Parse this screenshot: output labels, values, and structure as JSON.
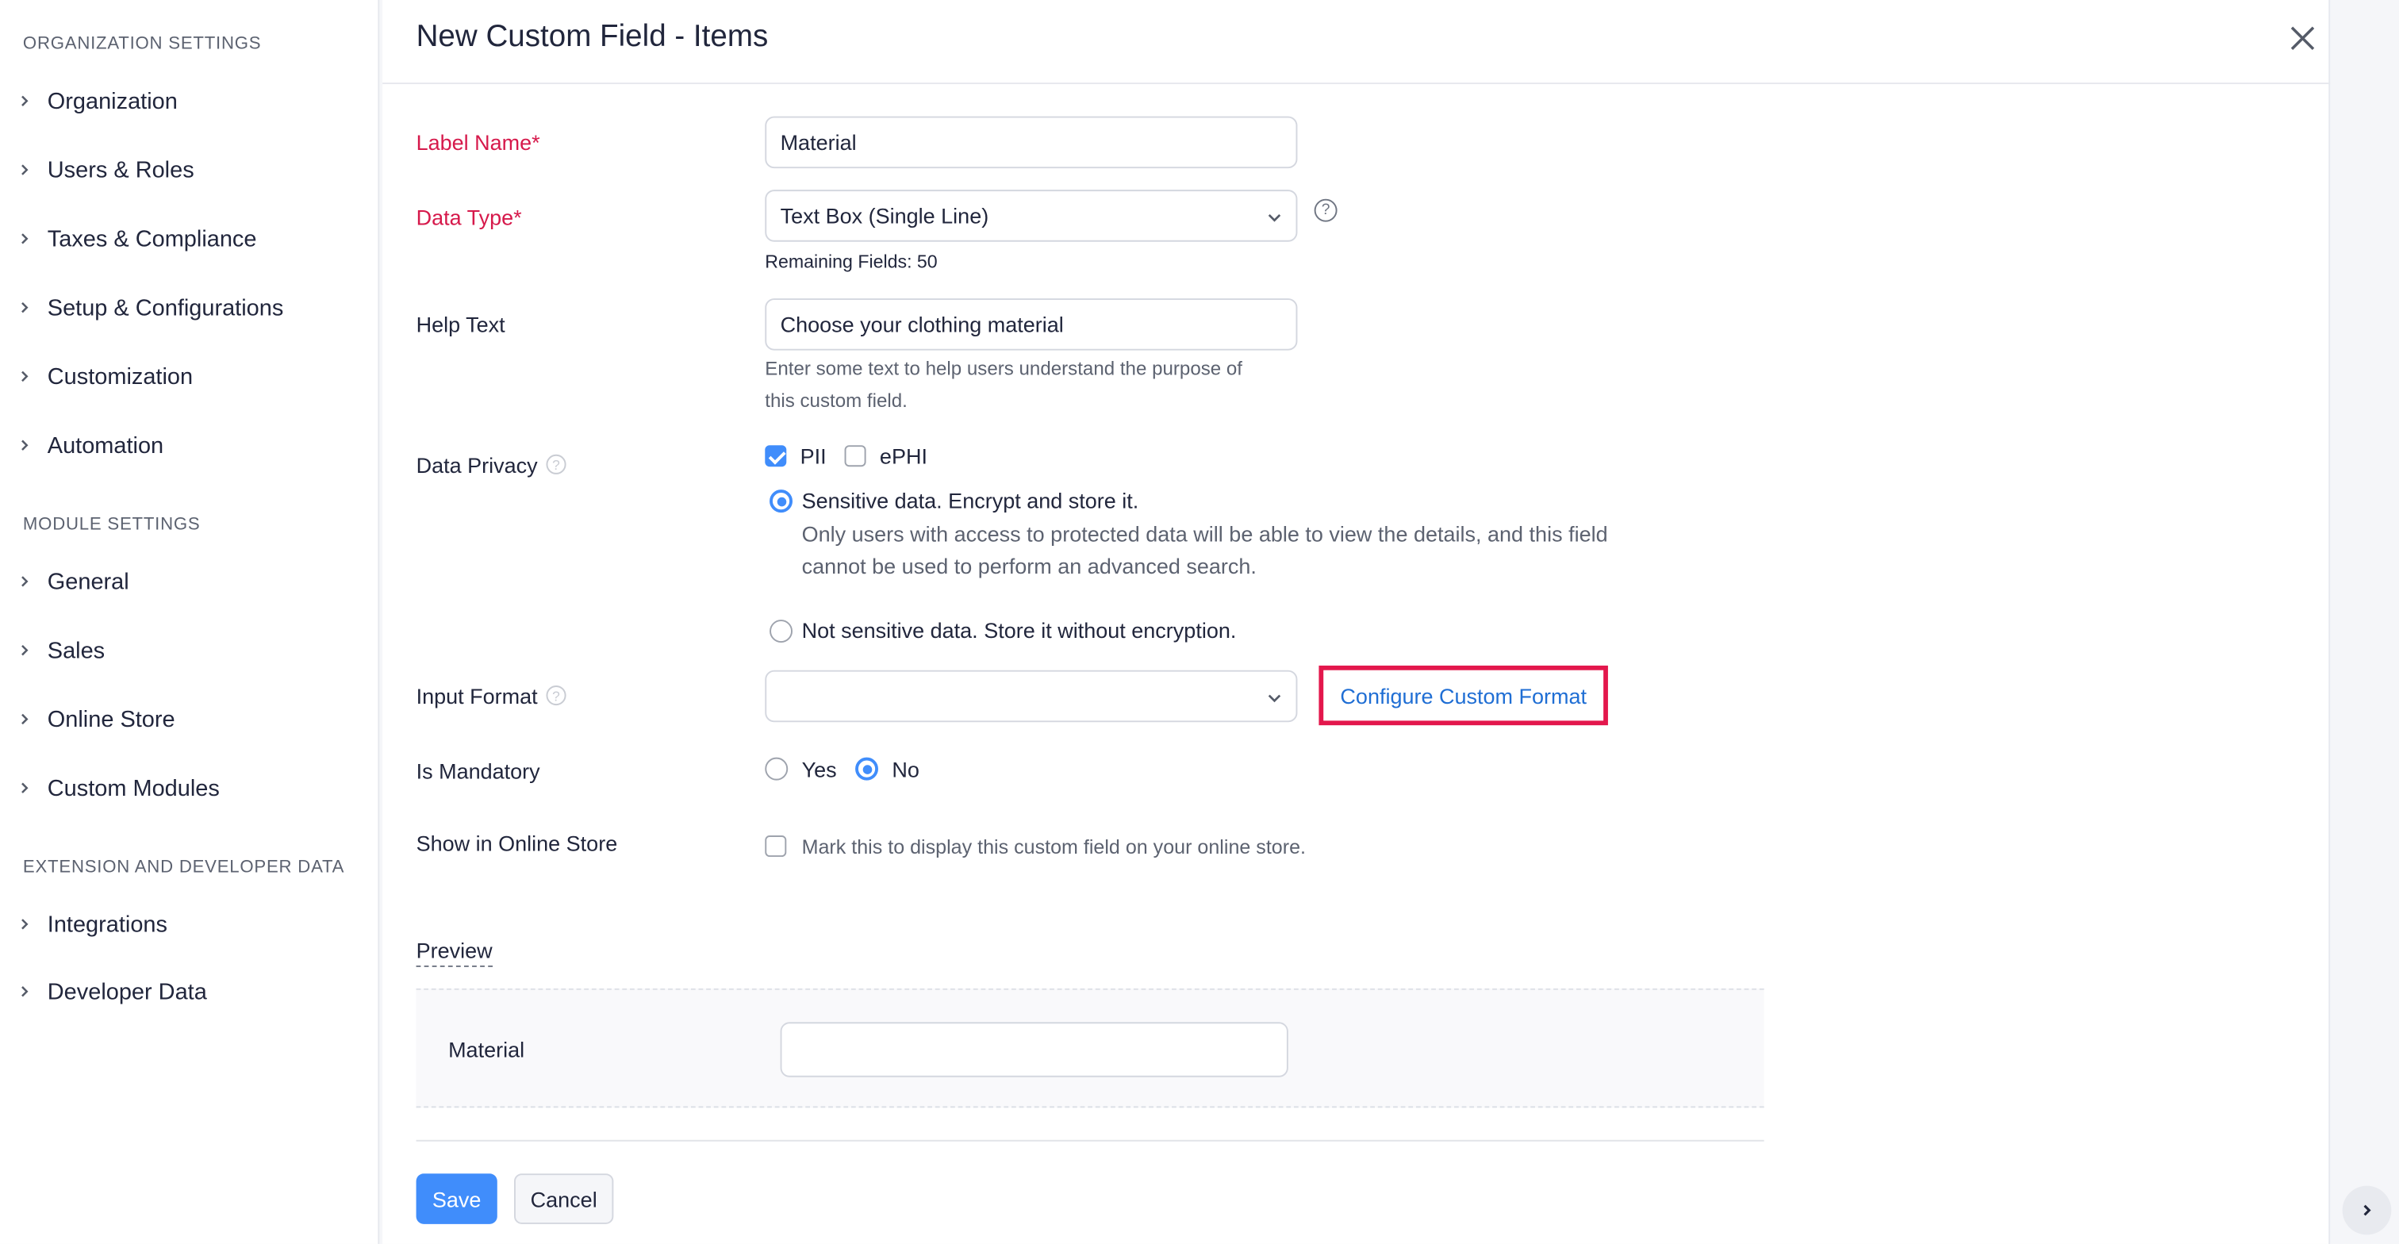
{
  "sidebar": {
    "sections": [
      {
        "title": "ORGANIZATION SETTINGS",
        "items": [
          "Organization",
          "Users & Roles",
          "Taxes & Compliance",
          "Setup & Configurations",
          "Customization",
          "Automation"
        ]
      },
      {
        "title": "MODULE SETTINGS",
        "items": [
          "General",
          "Sales",
          "Online Store",
          "Custom Modules"
        ]
      },
      {
        "title": "EXTENSION AND DEVELOPER DATA",
        "items": [
          "Integrations",
          "Developer Data"
        ]
      }
    ]
  },
  "header": {
    "title": "New Custom Field - Items"
  },
  "form": {
    "label_name": {
      "label": "Label Name*",
      "value": "Material"
    },
    "data_type": {
      "label": "Data Type*",
      "value": "Text Box (Single Line)",
      "remaining": "Remaining Fields: 50"
    },
    "help_text": {
      "label": "Help Text",
      "value": "Choose your clothing material",
      "hint_line1": "Enter some text to help users understand the purpose of",
      "hint_line2": "this custom field."
    },
    "data_privacy": {
      "label": "Data Privacy",
      "pii_label": "PII",
      "pii_checked": true,
      "ephi_label": "ePHI",
      "ephi_checked": false,
      "sensitive_label": "Sensitive data. Encrypt and store it.",
      "sensitive_desc_line1": "Only users with access to protected data will be able to view the details, and this field",
      "sensitive_desc_line2": "cannot be used to perform an advanced search.",
      "not_sensitive_label": "Not sensitive data. Store it without encryption.",
      "selected": "sensitive"
    },
    "input_format": {
      "label": "Input Format",
      "value": "",
      "configure_link": "Configure Custom Format"
    },
    "is_mandatory": {
      "label": "Is Mandatory",
      "yes_label": "Yes",
      "no_label": "No",
      "selected": "No"
    },
    "show_online": {
      "label": "Show in Online Store",
      "checkbox_label": "Mark this to display this custom field on your online store.",
      "checked": false
    }
  },
  "preview": {
    "title": "Preview",
    "field_label": "Material",
    "field_value": ""
  },
  "actions": {
    "save": "Save",
    "cancel": "Cancel"
  },
  "colors": {
    "accent": "#408dfb",
    "required": "#d6194b",
    "highlight_border": "#e3174c",
    "link": "#1f6ed4"
  }
}
